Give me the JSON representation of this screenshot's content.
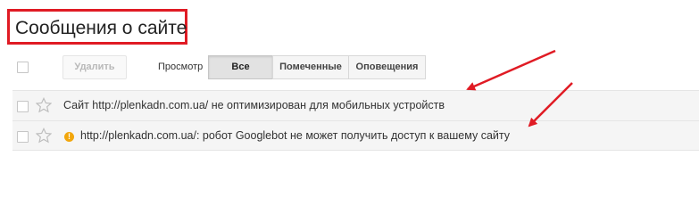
{
  "header": {
    "title": "Сообщения о сайте"
  },
  "toolbar": {
    "delete_label": "Удалить",
    "view_label": "Просмотр",
    "filters": [
      {
        "label": "Все",
        "active": true
      },
      {
        "label": "Помеченные",
        "active": false
      },
      {
        "label": "Оповещения",
        "active": false
      }
    ]
  },
  "messages": [
    {
      "text": "Сайт http://plenkadn.com.ua/ не оптимизирован для мобильных устройств",
      "icon": "none"
    },
    {
      "text": "http://plenkadn.com.ua/: робот Googlebot не может получить доступ к вашему сайту",
      "icon": "warning-icon"
    }
  ],
  "annotation_colors": {
    "highlight": "#e01b24",
    "warning": "#f2a60c"
  }
}
